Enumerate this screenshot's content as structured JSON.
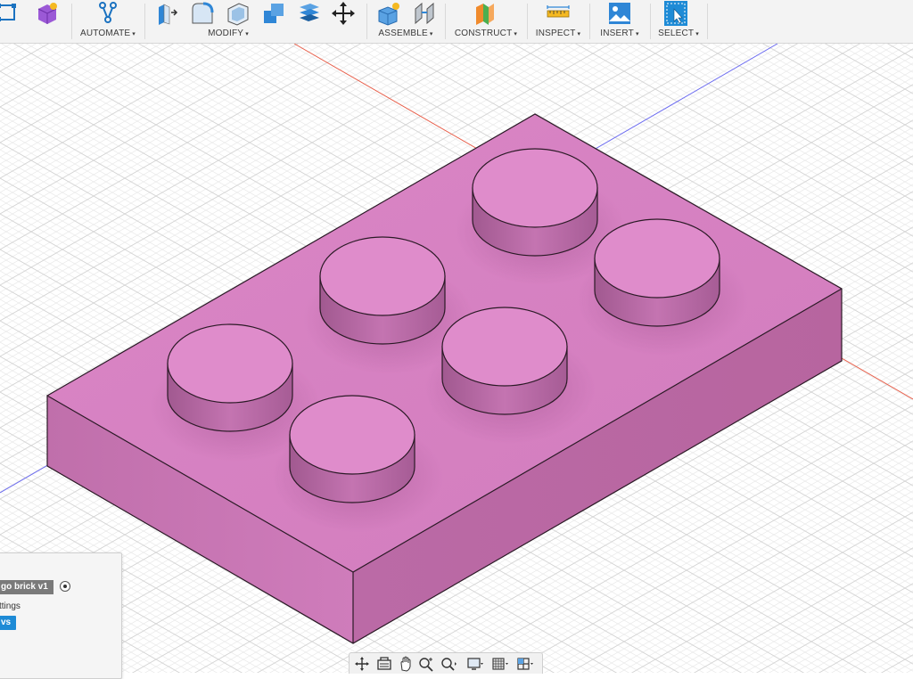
{
  "toolbar": {
    "groups": [
      {
        "id": "automate",
        "label": "AUTOMATE"
      },
      {
        "id": "modify",
        "label": "MODIFY"
      },
      {
        "id": "assemble",
        "label": "ASSEMBLE"
      },
      {
        "id": "construct",
        "label": "CONSTRUCT"
      },
      {
        "id": "inspect",
        "label": "INSPECT"
      },
      {
        "id": "insert",
        "label": "INSERT"
      },
      {
        "id": "select",
        "label": "SELECT"
      }
    ],
    "caret": "▾"
  },
  "browser": {
    "document_name": "go brick v1",
    "settings_label": "ttings",
    "views_label": "vs"
  },
  "model": {
    "body_color": "#d57fbf",
    "stud_count": 6
  },
  "colors": {
    "x_axis": "#e8604c",
    "z_axis": "#6b6bf0",
    "select_blue": "#1e8bd6"
  },
  "navbar": {
    "tools": [
      "orbit-icon",
      "look-at-icon",
      "pan-icon",
      "zoom-icon",
      "fit-icon",
      "display-settings-icon",
      "grid-settings-icon",
      "viewports-icon"
    ]
  }
}
